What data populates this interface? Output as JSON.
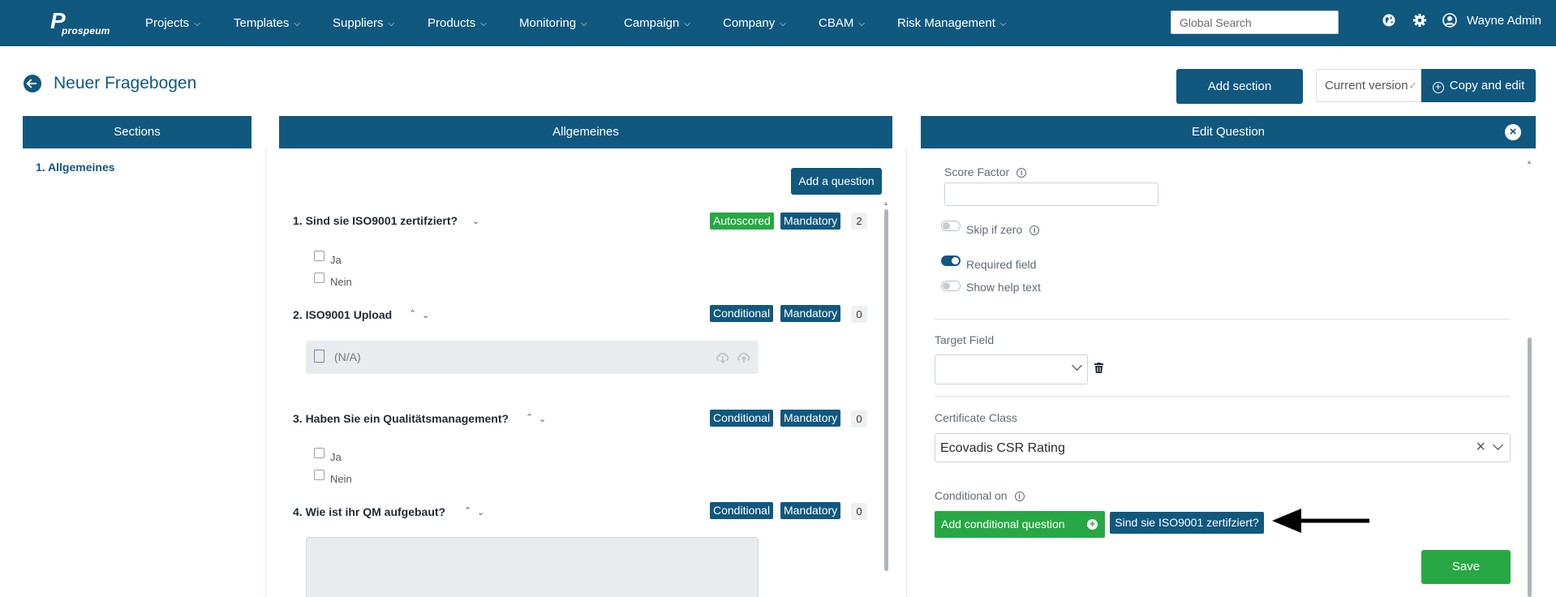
{
  "brand": {
    "logo_text": "prospeum",
    "logo_mark": "P"
  },
  "nav": {
    "items": [
      "Projects",
      "Templates",
      "Suppliers",
      "Products",
      "Monitoring",
      "Campaign",
      "Company",
      "CBAM",
      "Risk Management"
    ],
    "search_placeholder": "Global Search",
    "user_name": "Wayne Admin",
    "icons": [
      "globe-icon",
      "gear-icon",
      "user-icon"
    ]
  },
  "header": {
    "title": "Neuer Fragebogen",
    "add_section_label": "Add section",
    "version_label": "Current version",
    "copy_edit_label": "Copy and edit"
  },
  "sections_panel": {
    "title": "Sections",
    "items": [
      "1. Allgemeines"
    ]
  },
  "main_panel": {
    "title": "Allgemeines",
    "add_question_label": "Add a question",
    "questions": [
      {
        "title": "1. Sind sie ISO9001 zertifziert?",
        "badges": [
          "Autoscored",
          "Mandatory"
        ],
        "count": "2",
        "options": [
          "Ja",
          "Nein"
        ]
      },
      {
        "title": "2. ISO9001 Upload",
        "badges": [
          "Conditional",
          "Mandatory"
        ],
        "count": "0",
        "upload_value": "(N/A)"
      },
      {
        "title": "3. Haben Sie ein Qualitätsmanagement?",
        "badges": [
          "Conditional",
          "Mandatory"
        ],
        "count": "0",
        "options": [
          "Ja",
          "Nein"
        ]
      },
      {
        "title": "4. Wie ist ihr QM aufgebaut?",
        "badges": [
          "Conditional",
          "Mandatory"
        ],
        "count": "0"
      }
    ]
  },
  "edit_panel": {
    "title": "Edit Question",
    "score_factor_label": "Score Factor",
    "score_factor_value": "",
    "toggles": [
      {
        "label": "Skip if zero",
        "on": false
      },
      {
        "label": "Required field",
        "on": true
      },
      {
        "label": "Show help text",
        "on": false
      }
    ],
    "target_field_label": "Target Field",
    "target_field_value": "",
    "certificate_class_label": "Certificate Class",
    "certificate_class_value": "Ecovadis CSR Rating",
    "conditional_on_label": "Conditional on",
    "add_conditional_label": "Add conditional question",
    "conditional_chip": "Sind sie ISO9001 zertifziert?",
    "save_label": "Save"
  },
  "colors": {
    "primary": "#11587f",
    "success": "#27a844",
    "muted": "#e9ecef"
  }
}
